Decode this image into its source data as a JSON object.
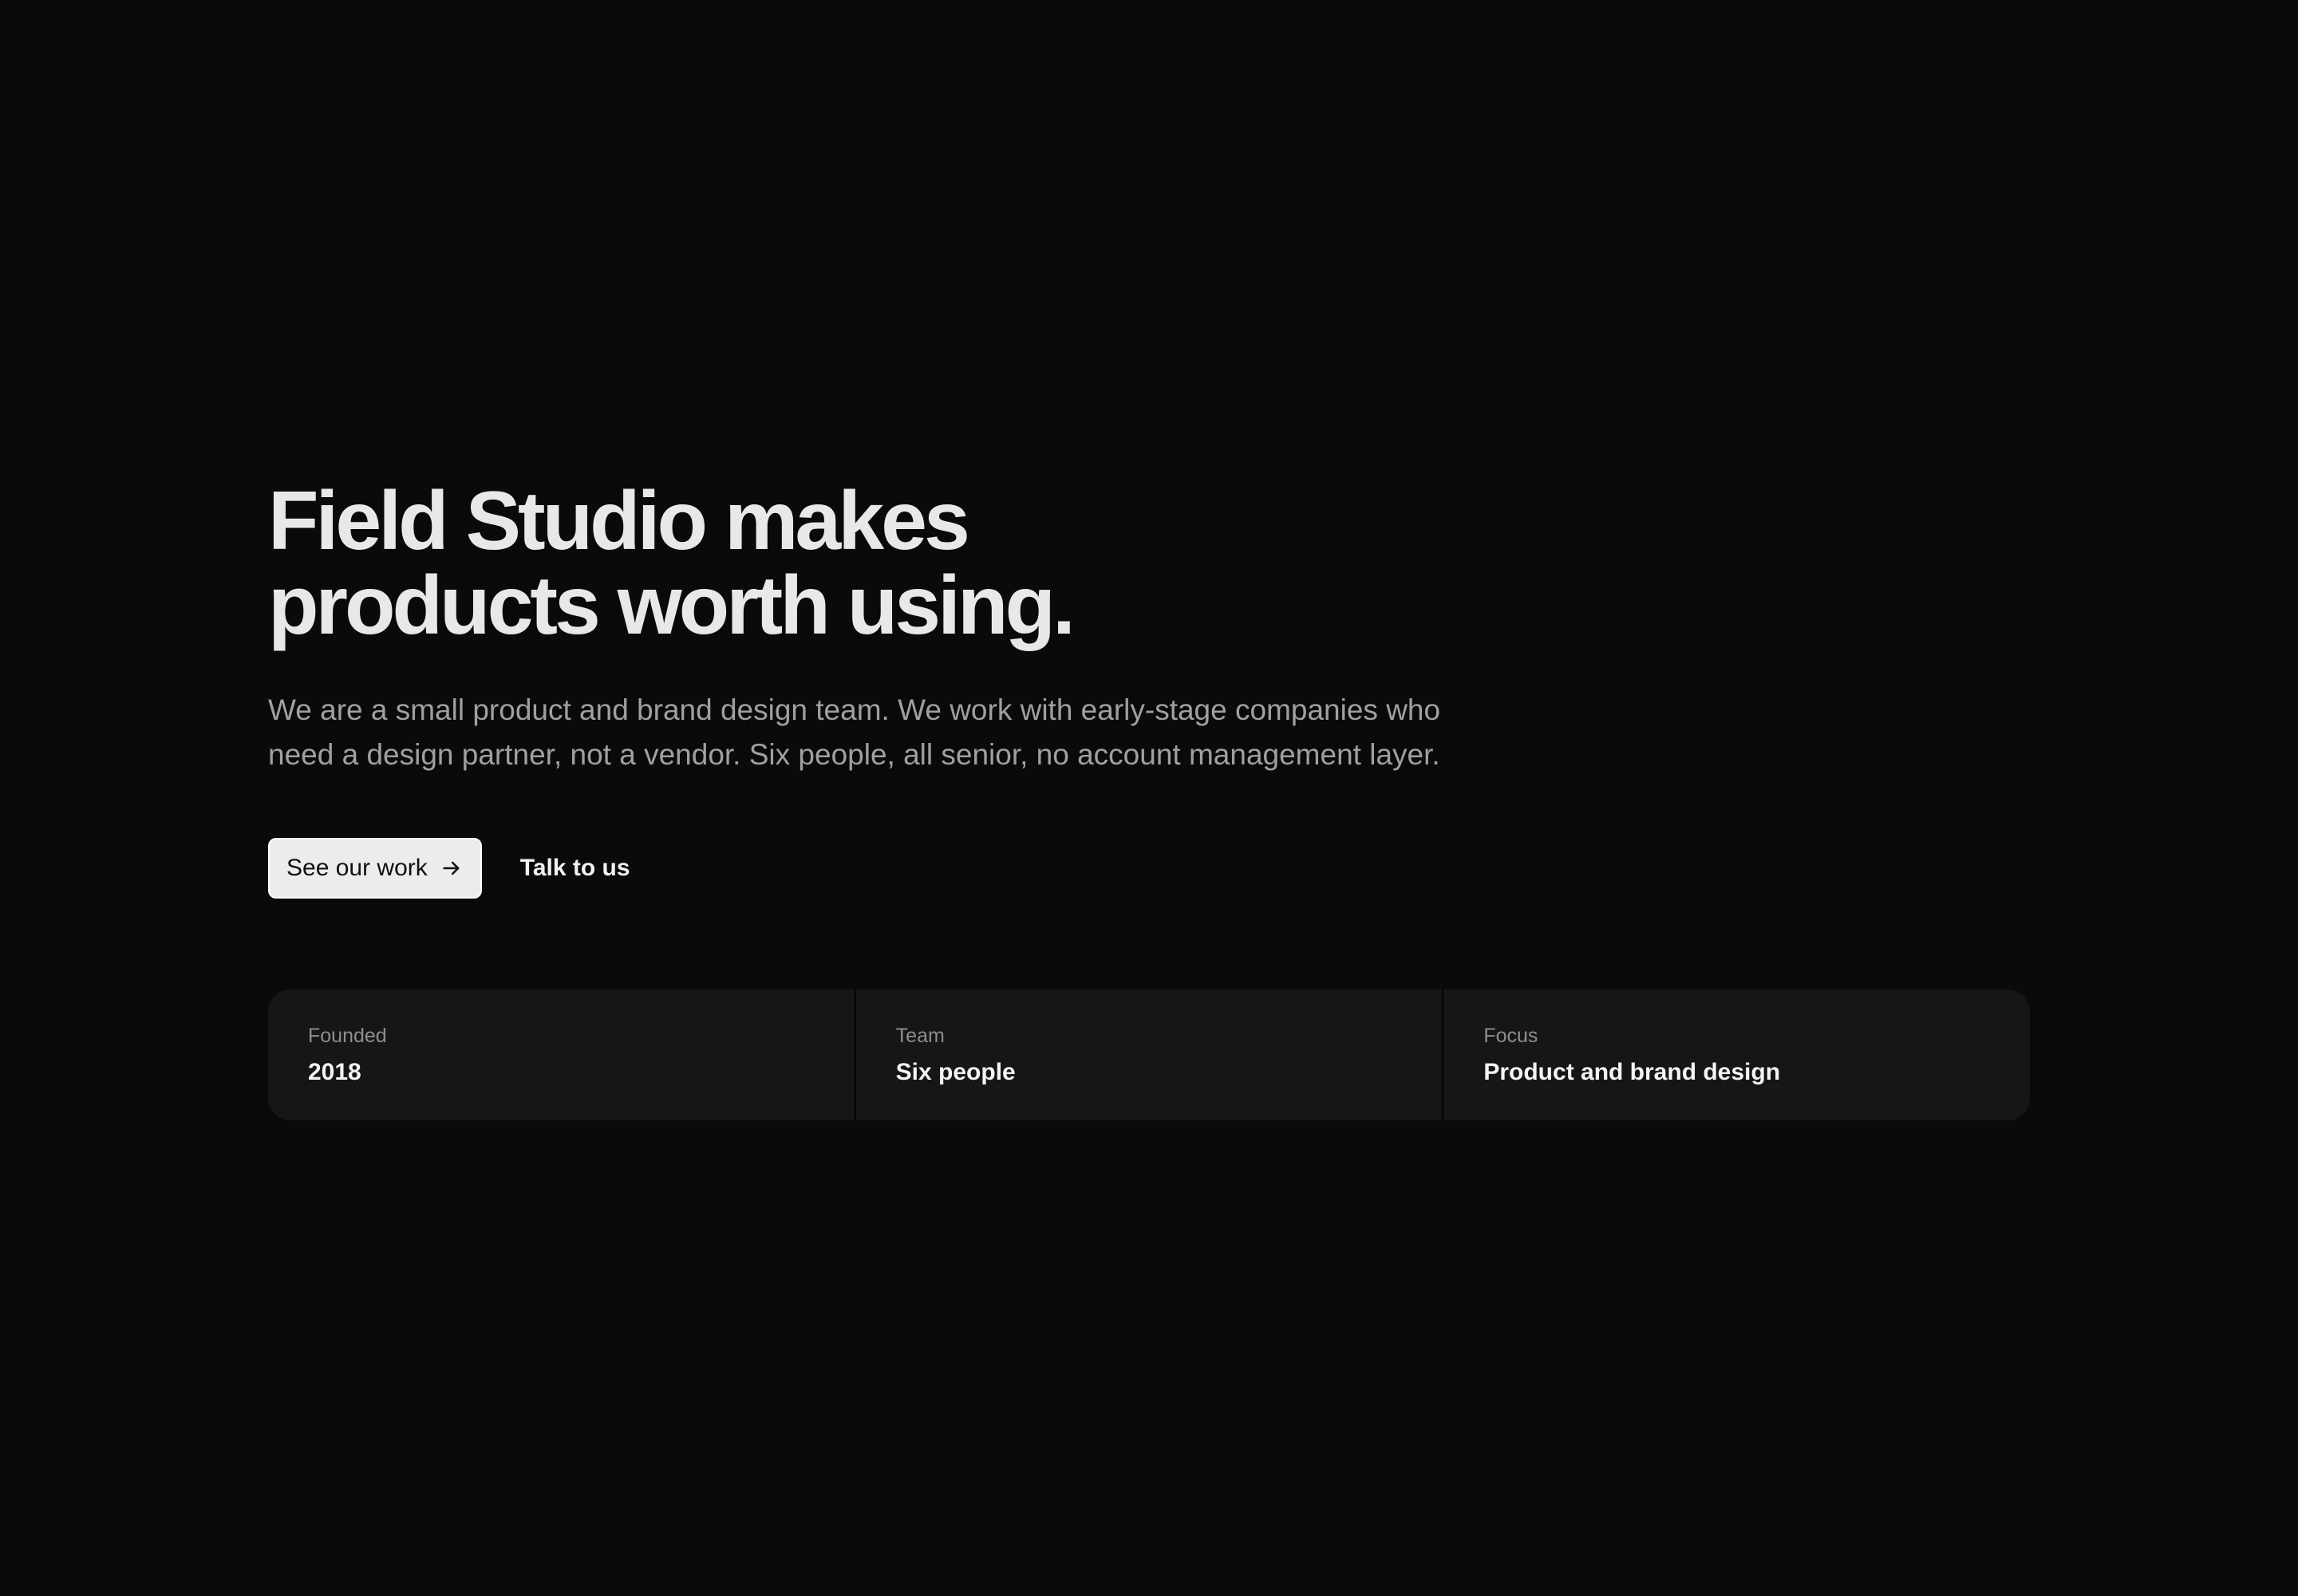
{
  "hero": {
    "headline_line1": "Field Studio makes",
    "headline_line2": "products worth using.",
    "lede": "We are a small product and brand design team. We work with early-stage companies who need a design partner, not a vendor. Six people, all senior, no account management layer.",
    "primary_cta": "See our work",
    "primary_cta_icon": "arrow-right-icon",
    "secondary_cta": "Talk to us"
  },
  "facts": [
    {
      "label": "Founded",
      "value": "2018"
    },
    {
      "label": "Team",
      "value": "Six people"
    },
    {
      "label": "Focus",
      "value": "Product and brand design"
    }
  ],
  "colors": {
    "background": "#0a0a0a",
    "card": "#161616",
    "button": "#ececec",
    "text_primary": "#e8e8e8",
    "text_muted": "#a0a0a0"
  }
}
